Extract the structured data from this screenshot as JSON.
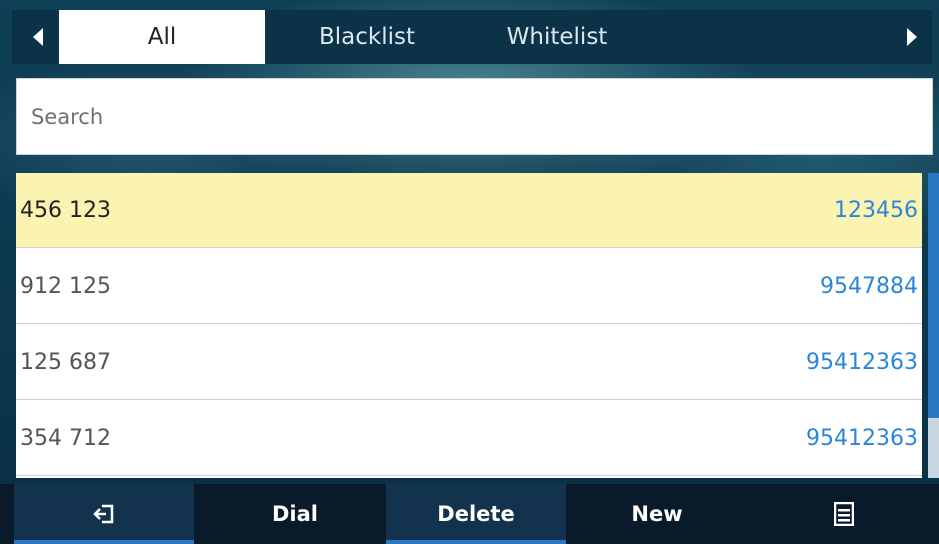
{
  "tabs": {
    "all": "All",
    "blacklist": "Blacklist",
    "whitelist": "Whitelist",
    "active": "All",
    "left_arrow_icon": "left-triangle-icon",
    "right_arrow_icon": "right-triangle-icon"
  },
  "search": {
    "placeholder": "Search",
    "value": ""
  },
  "contacts": [
    {
      "name": "456 123",
      "number": "123456",
      "selected": true
    },
    {
      "name": "912 125",
      "number": "9547884",
      "selected": false
    },
    {
      "name": "125 687",
      "number": "95412363",
      "selected": false
    },
    {
      "name": "354 712",
      "number": "95412363",
      "selected": false
    }
  ],
  "softkeys": {
    "back_icon": "back-enter-icon",
    "dial": "Dial",
    "delete": "Delete",
    "new": "New",
    "menu_icon": "menu-list-icon"
  },
  "colors": {
    "selected_row": "#fbf3b1",
    "number_text": "#2b86d8",
    "accent": "#2a78c2",
    "background": "#0d3a50"
  }
}
